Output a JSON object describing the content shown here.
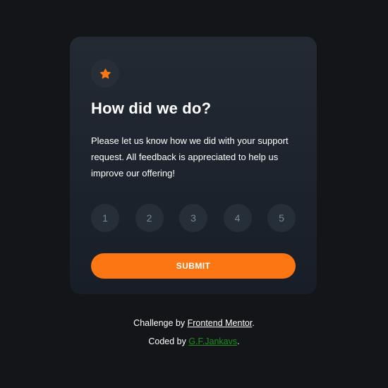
{
  "card": {
    "icon": "star-icon",
    "title": "How did we do?",
    "description": "Please let us know how we did with your support request. All feedback is appreciated to help us improve our offering!",
    "ratings": [
      "1",
      "2",
      "3",
      "4",
      "5"
    ],
    "submit_label": "SUBMIT"
  },
  "attribution": {
    "line1_prefix": "Challenge by ",
    "line1_link": "Frontend Mentor",
    "line1_suffix": ".",
    "line2_prefix": "Coded by ",
    "line2_link": "G.F.Jankavs",
    "line2_suffix": "."
  },
  "colors": {
    "background": "#131518",
    "card": "#1f252e",
    "accent": "#fc7614",
    "rating_bg": "#262f38",
    "rating_text": "#7c8798",
    "coder_link": "#1c8f1c"
  }
}
